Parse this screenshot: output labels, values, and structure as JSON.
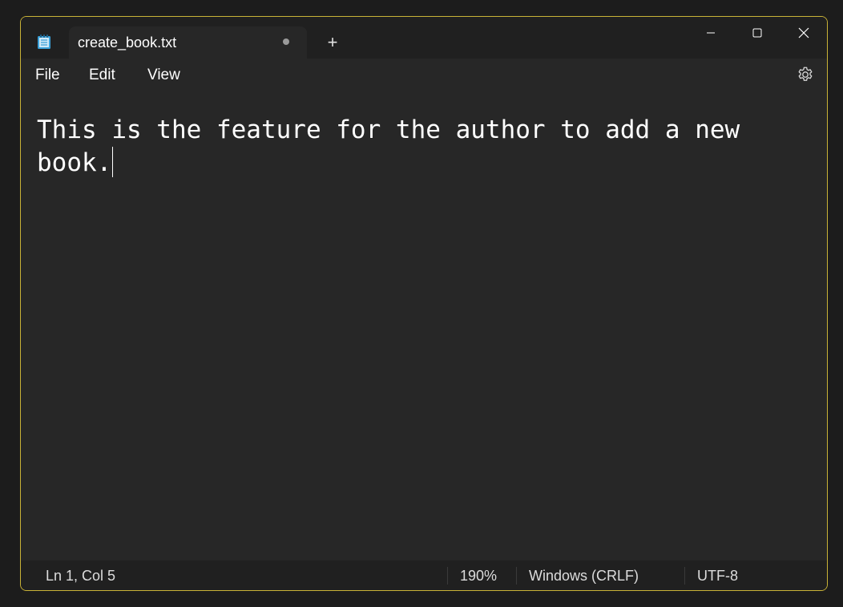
{
  "window": {
    "accent_border": "#c9b237",
    "background": "#272727"
  },
  "tab": {
    "title": "create_book.txt",
    "unsaved_indicator": "dot",
    "icon": "notepad-icon"
  },
  "titlebar": {
    "new_tab_label": "+",
    "controls": [
      "minimize-icon",
      "maximize-icon",
      "close-icon"
    ]
  },
  "menu": {
    "file_label": "File",
    "edit_label": "Edit",
    "view_label": "View",
    "settings_icon": "gear-icon"
  },
  "editor": {
    "content": "This is the feature for the author to add a new book."
  },
  "status": {
    "position": "Ln 1, Col 5",
    "zoom": "190%",
    "line_ending": "Windows (CRLF)",
    "encoding": "UTF-8"
  }
}
